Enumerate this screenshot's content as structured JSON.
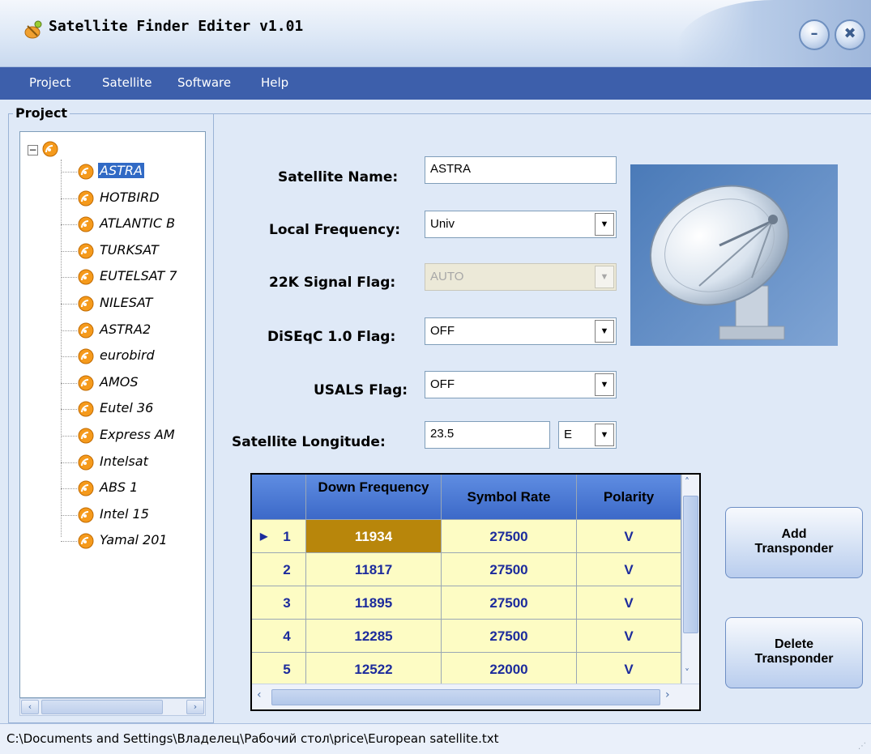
{
  "window": {
    "title": "Satellite Finder Editer  v1.01",
    "minimize_glyph": "–",
    "close_glyph": "✖"
  },
  "menu": {
    "items": [
      "Project",
      "Satellite",
      "Software",
      "Help"
    ]
  },
  "project": {
    "legend": "Project",
    "root_toggle": "⊟",
    "items": [
      "ASTRA",
      "HOTBIRD",
      "ATLANTIC B",
      "TURKSAT",
      "EUTELSAT 7",
      "NILESAT",
      "ASTRA2",
      "eurobird",
      "AMOS",
      "Eutel 36",
      "Express AM",
      "Intelsat",
      "ABS 1",
      "Intel 15",
      "Yamal 201"
    ],
    "selected": "ASTRA"
  },
  "form": {
    "satellite_name_label": "Satellite Name:",
    "satellite_name_value": "ASTRA",
    "local_frequency_label": "Local Frequency:",
    "local_frequency_value": "Univ",
    "signal_flag_label": "22K Signal Flag:",
    "signal_flag_value": "AUTO",
    "diseqc_label": "DiSEqC 1.0 Flag:",
    "diseqc_value": "OFF",
    "usals_label": "USALS Flag:",
    "usals_value": "OFF",
    "longitude_label": "Satellite Longitude:",
    "longitude_value": "23.5",
    "longitude_dir": "E"
  },
  "grid": {
    "headers": [
      "",
      "Down Frequency",
      "Symbol Rate",
      "Polarity"
    ],
    "rows": [
      {
        "index": "1",
        "freq": "11934",
        "rate": "27500",
        "pol": "V"
      },
      {
        "index": "2",
        "freq": "11817",
        "rate": "27500",
        "pol": "V"
      },
      {
        "index": "3",
        "freq": "11895",
        "rate": "27500",
        "pol": "V"
      },
      {
        "index": "4",
        "freq": "12285",
        "rate": "27500",
        "pol": "V"
      },
      {
        "index": "5",
        "freq": "12522",
        "rate": "22000",
        "pol": "V"
      }
    ],
    "current_row_marker": "▶"
  },
  "buttons": {
    "add_line1": "Add",
    "add_line2": "Transponder",
    "delete_line1": "Delete",
    "delete_line2": "Transponder"
  },
  "status": {
    "path": "C:\\Documents and Settings\\Владелец\\Рабочий стол\\price\\European satellite.txt"
  },
  "icons": {
    "app": "satellite-app-icon",
    "tree_node": "satellite-node-icon",
    "dropdown": "▼",
    "scroll_left": "‹",
    "scroll_right": "›",
    "scroll_up": "˄",
    "scroll_down": "˅"
  },
  "colors": {
    "menu_bg": "#3d5fab",
    "grid_header": "#4a78d6",
    "grid_cell": "#fdfcc4",
    "grid_selected": "#b8860b",
    "selection": "#316ac5"
  }
}
